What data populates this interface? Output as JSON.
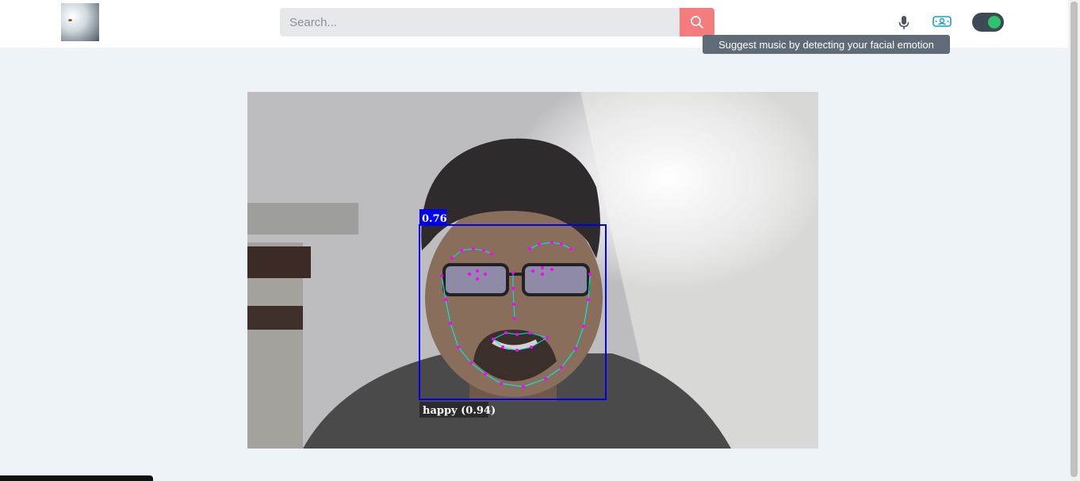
{
  "header": {
    "search": {
      "placeholder": "Search..."
    },
    "tooltip": "Suggest music by detecting your facial emotion"
  },
  "icons": {
    "logo": "logo-image",
    "search": "search-icon",
    "mic": "microphone-icon",
    "emotion": "face-detect-icon",
    "toggle": "toggle-switch"
  },
  "detection": {
    "score": "0.76",
    "label": "happy (0.94)",
    "box_color": "#0000ee",
    "landmark_color": "#ff00ff",
    "contour_color": "#00e5e5"
  },
  "colors": {
    "search_button": "#f47c7c",
    "toggle_track": "#3d4a56",
    "toggle_knob": "#2fc26a",
    "tooltip_bg": "#5f6b77",
    "page_bg": "#edf3f6"
  }
}
